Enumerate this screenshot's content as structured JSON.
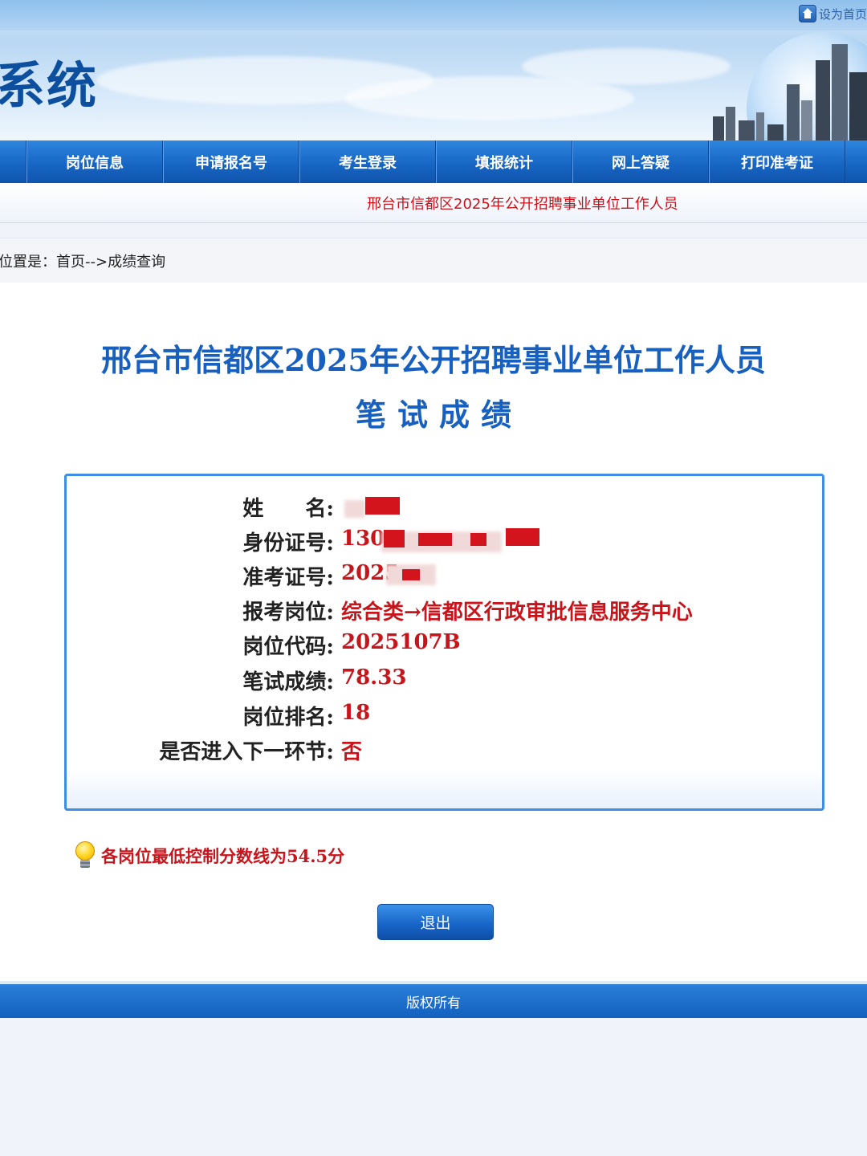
{
  "header": {
    "site_title": "系统",
    "set_home_label": "设为首页"
  },
  "nav": {
    "items": [
      {
        "label": "岗位信息"
      },
      {
        "label": "申请报名号"
      },
      {
        "label": "考生登录"
      },
      {
        "label": "填报统计"
      },
      {
        "label": "网上答疑"
      },
      {
        "label": "打印准考证"
      }
    ]
  },
  "subheader": {
    "title": "邢台市信都区2025年公开招聘事业单位工作人员"
  },
  "breadcrumb": {
    "text": "位置是：首页-->成绩查询"
  },
  "page": {
    "title": "邢台市信都区2025年公开招聘事业单位工作人员",
    "subtitle": "笔试成绩"
  },
  "result": {
    "fields": [
      {
        "label": "姓　　名:",
        "value": ""
      },
      {
        "label": "身份证号:",
        "value": "130"
      },
      {
        "label": "准考证号:",
        "value": "2025"
      },
      {
        "label": "报考岗位:",
        "value": "综合类→信都区行政审批信息服务中心"
      },
      {
        "label": "岗位代码:",
        "value": "2025107B"
      },
      {
        "label": "笔试成绩:",
        "value": "78.33"
      },
      {
        "label": "岗位排名:",
        "value": "18"
      },
      {
        "label": "是否进入下一环节:",
        "value": "否"
      }
    ]
  },
  "tip": {
    "icon": "lightbulb-icon",
    "text": "各岗位最低控制分数线为54.5分"
  },
  "actions": {
    "exit_label": "退出"
  },
  "footer": {
    "text": "版权所有"
  },
  "colors": {
    "primary_blue": "#1766c4",
    "title_blue": "#1760c0",
    "value_red": "#c8141b"
  }
}
